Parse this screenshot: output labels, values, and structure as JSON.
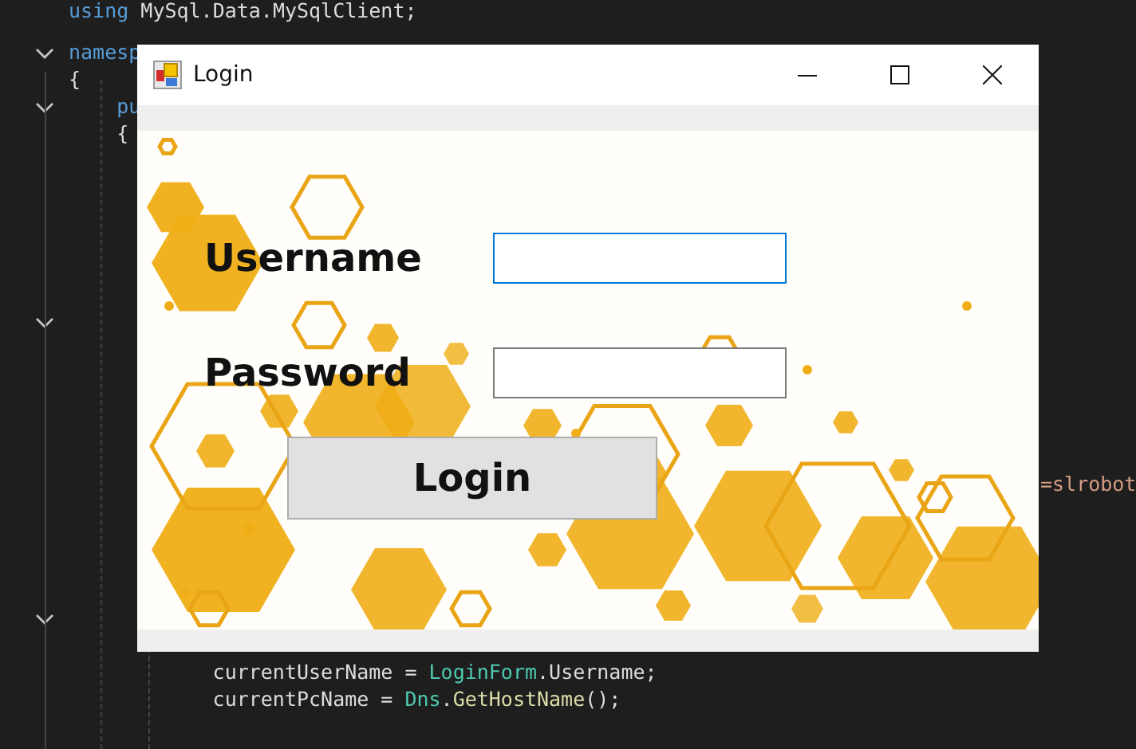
{
  "editor": {
    "lines": [
      {
        "tokens": [
          {
            "kind": "keyword",
            "text": "using"
          },
          {
            "kind": "plain",
            "text": " MySql.Data.MySqlClient;"
          }
        ]
      },
      {
        "tokens": [
          {
            "kind": "keyword",
            "text": "namesp"
          }
        ]
      },
      {
        "tokens": [
          {
            "kind": "plain",
            "text": "{"
          }
        ]
      },
      {
        "tokens": [
          {
            "kind": "keyword",
            "text": "    pu"
          }
        ]
      },
      {
        "tokens": [
          {
            "kind": "plain",
            "text": "    {"
          }
        ]
      },
      {
        "tokens": [
          {
            "kind": "plain",
            "text": "            currentUserName = "
          },
          {
            "kind": "type",
            "text": "LoginForm"
          },
          {
            "kind": "plain",
            "text": ".Username;"
          }
        ]
      },
      {
        "tokens": [
          {
            "kind": "plain",
            "text": "            currentPcName = "
          },
          {
            "kind": "type",
            "text": "Dns"
          },
          {
            "kind": "plain",
            "text": "."
          },
          {
            "kind": "method",
            "text": "GetHostName"
          },
          {
            "kind": "plain",
            "text": "();"
          }
        ]
      }
    ],
    "fragment": {
      "text": "=slrobot"
    },
    "fold_rows": [
      {
        "expanded": true
      },
      {
        "expanded": true
      },
      {
        "expanded": true
      },
      {
        "expanded": true
      }
    ]
  },
  "window": {
    "title": "Login"
  },
  "form": {
    "username": {
      "label": "Username",
      "focused": true
    },
    "password": {
      "label": "Password",
      "focused": false
    },
    "button": "Login"
  }
}
